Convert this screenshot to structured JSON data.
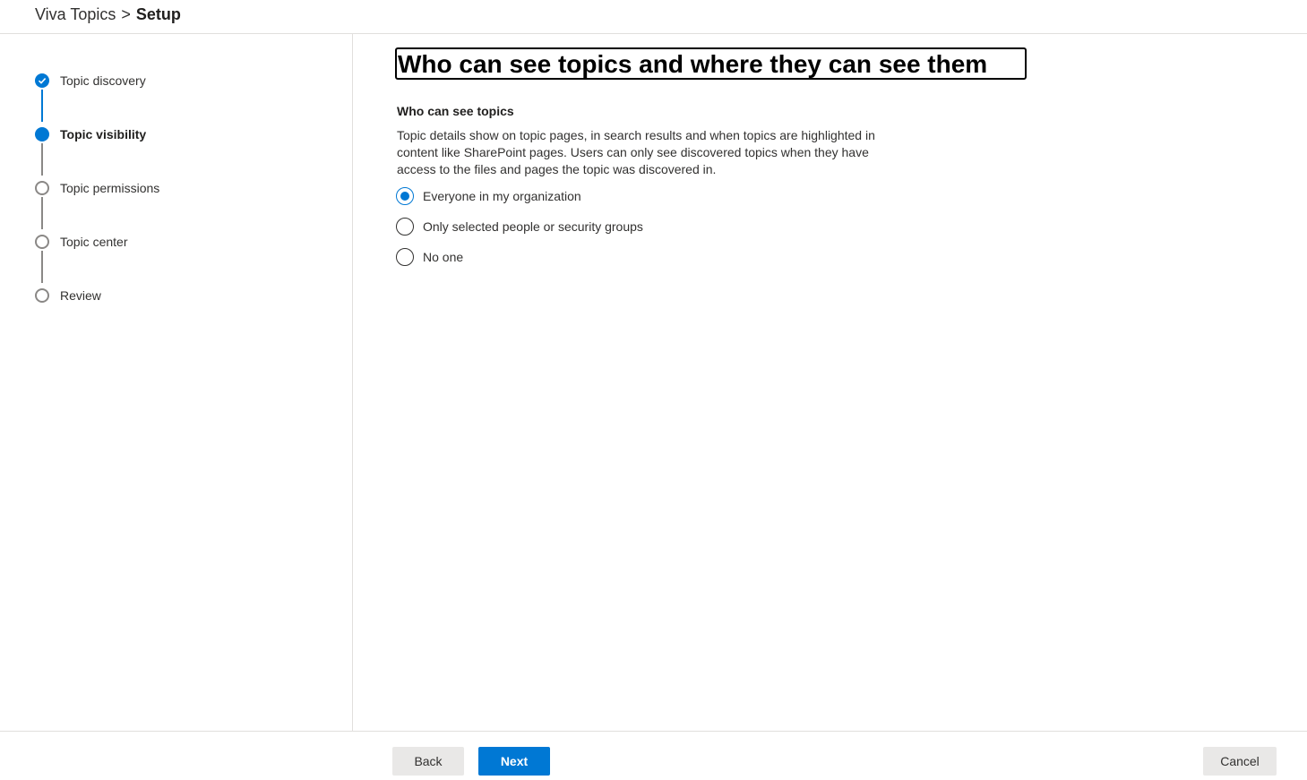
{
  "header": {
    "breadcrumb_parent": "Viva Topics",
    "breadcrumb_separator": ">",
    "breadcrumb_current": "Setup"
  },
  "steps": [
    {
      "label": "Topic discovery",
      "state": "done"
    },
    {
      "label": "Topic visibility",
      "state": "current"
    },
    {
      "label": "Topic permissions",
      "state": "todo"
    },
    {
      "label": "Topic center",
      "state": "todo"
    },
    {
      "label": "Review",
      "state": "todo"
    }
  ],
  "main": {
    "title": "Who can see topics and where they can see them",
    "section_title": "Who can see topics",
    "section_desc": "Topic details show on topic pages, in search results and when topics are highlighted in content like SharePoint pages. Users can only see discovered topics when they have access to the files and pages the topic was discovered in.",
    "options": [
      {
        "label": "Everyone in my organization",
        "selected": true
      },
      {
        "label": "Only selected people or security groups",
        "selected": false
      },
      {
        "label": "No one",
        "selected": false
      }
    ]
  },
  "footer": {
    "back_label": "Back",
    "next_label": "Next",
    "cancel_label": "Cancel"
  },
  "colors": {
    "accent": "#0078d4",
    "inactive": "#8a8886",
    "button_secondary": "#e9e8e7"
  }
}
